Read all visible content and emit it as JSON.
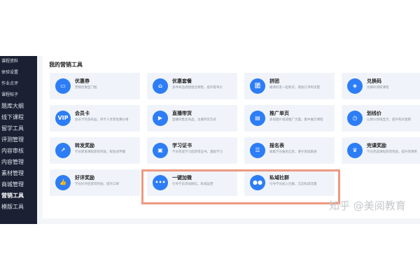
{
  "sidebar": {
    "items": [
      {
        "label": "课程资料",
        "size": "s"
      },
      {
        "label": "体验设置",
        "size": "s"
      },
      {
        "label": "作业点评",
        "size": "s"
      },
      {
        "label": "课程帖子",
        "size": "s"
      },
      {
        "label": "题库大纲",
        "size": "l"
      },
      {
        "label": "线下课程",
        "size": "l"
      },
      {
        "label": "留学工具",
        "size": "l"
      },
      {
        "label": "评测管理",
        "size": "l"
      },
      {
        "label": "内容审核",
        "size": "l"
      },
      {
        "label": "内容管理",
        "size": "l"
      },
      {
        "label": "素材管理",
        "size": "l"
      },
      {
        "label": "商城管理",
        "size": "l"
      },
      {
        "label": "营销工具",
        "size": "l",
        "active": true
      },
      {
        "label": "模版工具",
        "size": "l"
      }
    ]
  },
  "panel": {
    "title": "我的营销工具"
  },
  "tools": [
    {
      "name": "优惠券",
      "icon": "ticket-icon",
      "glyph": "▭",
      "desc": "营销优惠型门槛"
    },
    {
      "name": "优惠套餐",
      "icon": "basket-icon",
      "glyph": "⌂",
      "desc": "多件商品搭配组合销售，提升客单价"
    },
    {
      "name": "拼团",
      "icon": "group-icon",
      "glyph": "团",
      "desc": "邀请好友一起购买，增加订单和流量"
    },
    {
      "name": "兑换码",
      "icon": "tag-icon",
      "glyph": "◈",
      "desc": "兑换码领取课程"
    },
    {
      "name": "会员卡",
      "icon": "vip-icon",
      "glyph": "VIP",
      "desc": "会员卡的多权益，持卡人享受优惠价格"
    },
    {
      "name": "直播带货",
      "icon": "live-icon",
      "glyph": "▶",
      "desc": "直播间售卖商品，主播带货方式"
    },
    {
      "name": "推广单页",
      "icon": "page-icon",
      "glyph": "▤",
      "desc": "多张图片组成推广页面，集中展示课程"
    },
    {
      "name": "划线价",
      "icon": "clock-icon",
      "glyph": "◷",
      "desc": "以原价划线显示，提升购买意愿"
    },
    {
      "name": "转发奖励",
      "icon": "share-icon",
      "glyph": "↗",
      "desc": "学员转发课程获得奖励，裂变式传播"
    },
    {
      "name": "学习证书",
      "icon": "certificate-icon",
      "glyph": "▣",
      "desc": "学员完成学习后获得证书，激励学习"
    },
    {
      "name": "报名表",
      "icon": "form-icon",
      "glyph": "☰",
      "desc": "收集学员报名信息，便于后续跟进"
    },
    {
      "name": "完课奖励",
      "icon": "trophy-icon",
      "glyph": "♛",
      "desc": "学员完成课程获得奖励，提升完课率"
    },
    {
      "name": "好评奖励",
      "icon": "thumbs-up-icon",
      "glyph": "👍",
      "desc": "学员好评后获得奖励，提升口碑"
    },
    {
      "name": "一键加微",
      "icon": "chat-icon",
      "glyph": "•••",
      "desc": "引导学员添加微信，私域运营"
    },
    {
      "name": "私域社群",
      "icon": "community-icon",
      "glyph": "●●",
      "desc": "引导学员加入社群，沉淀私域流量"
    }
  ],
  "watermark": "知乎 @美阅教育"
}
